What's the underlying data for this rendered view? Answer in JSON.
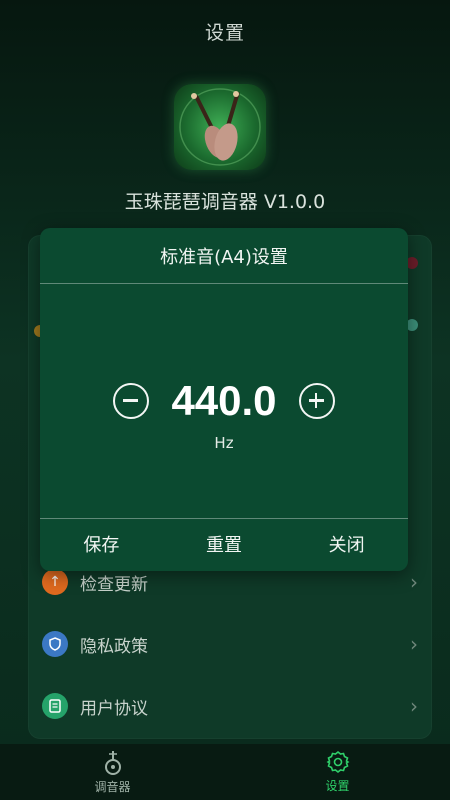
{
  "header": {
    "title": "设置"
  },
  "app": {
    "icon": "pipa-app-icon",
    "name": "玉珠琵琶调音器 V1.0.0"
  },
  "settings": {
    "items": [
      {
        "label": "检查更新",
        "icon": "upload-icon",
        "color": "#e06a1f"
      },
      {
        "label": "隐私政策",
        "icon": "shield-icon",
        "color": "#3b78c4"
      },
      {
        "label": "用户协议",
        "icon": "document-icon",
        "color": "#25a36a"
      }
    ],
    "chevron": "›"
  },
  "dialog": {
    "title": "标准音(A4)设置",
    "value": "440.0",
    "unit": "Hz",
    "save_label": "保存",
    "reset_label": "重置",
    "close_label": "关闭"
  },
  "nav": {
    "tuner_label": "调音器",
    "settings_label": "设置",
    "active": "设置",
    "active_color": "#2fd06a"
  }
}
